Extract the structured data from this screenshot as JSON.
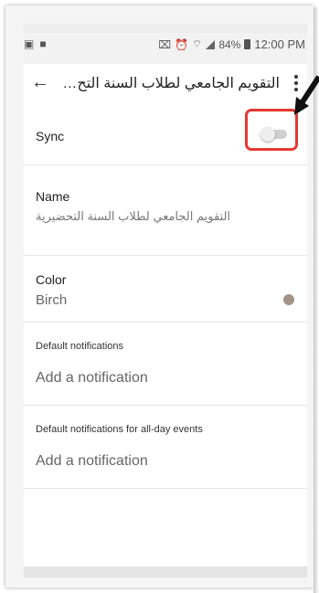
{
  "status_bar": {
    "left_icons": [
      "image-icon",
      "video-icon"
    ],
    "right_icons": [
      "mute-icon",
      "alarm-icon",
      "wifi-icon",
      "signal-icon"
    ],
    "battery_percent": "84%",
    "time": "12:00 PM"
  },
  "app_bar": {
    "title": "التقويم الجامعي لطلاب السنة التح…",
    "back_icon": "arrow-back-icon",
    "menu_icon": "more-vert-icon"
  },
  "settings": {
    "sync": {
      "label": "Sync",
      "enabled": false
    },
    "name": {
      "label": "Name",
      "value": "التقويم الجامعي لطلاب السنة التحضيرية"
    },
    "color": {
      "label": "Color",
      "value": "Birch",
      "swatch": "#a39387"
    },
    "default_notifications": {
      "label": "Default notifications",
      "action": "Add a notification"
    },
    "allday_notifications": {
      "label": "Default notifications for all-day events",
      "action": "Add a notification"
    }
  },
  "annotation": {
    "highlight_color": "#e53935"
  }
}
